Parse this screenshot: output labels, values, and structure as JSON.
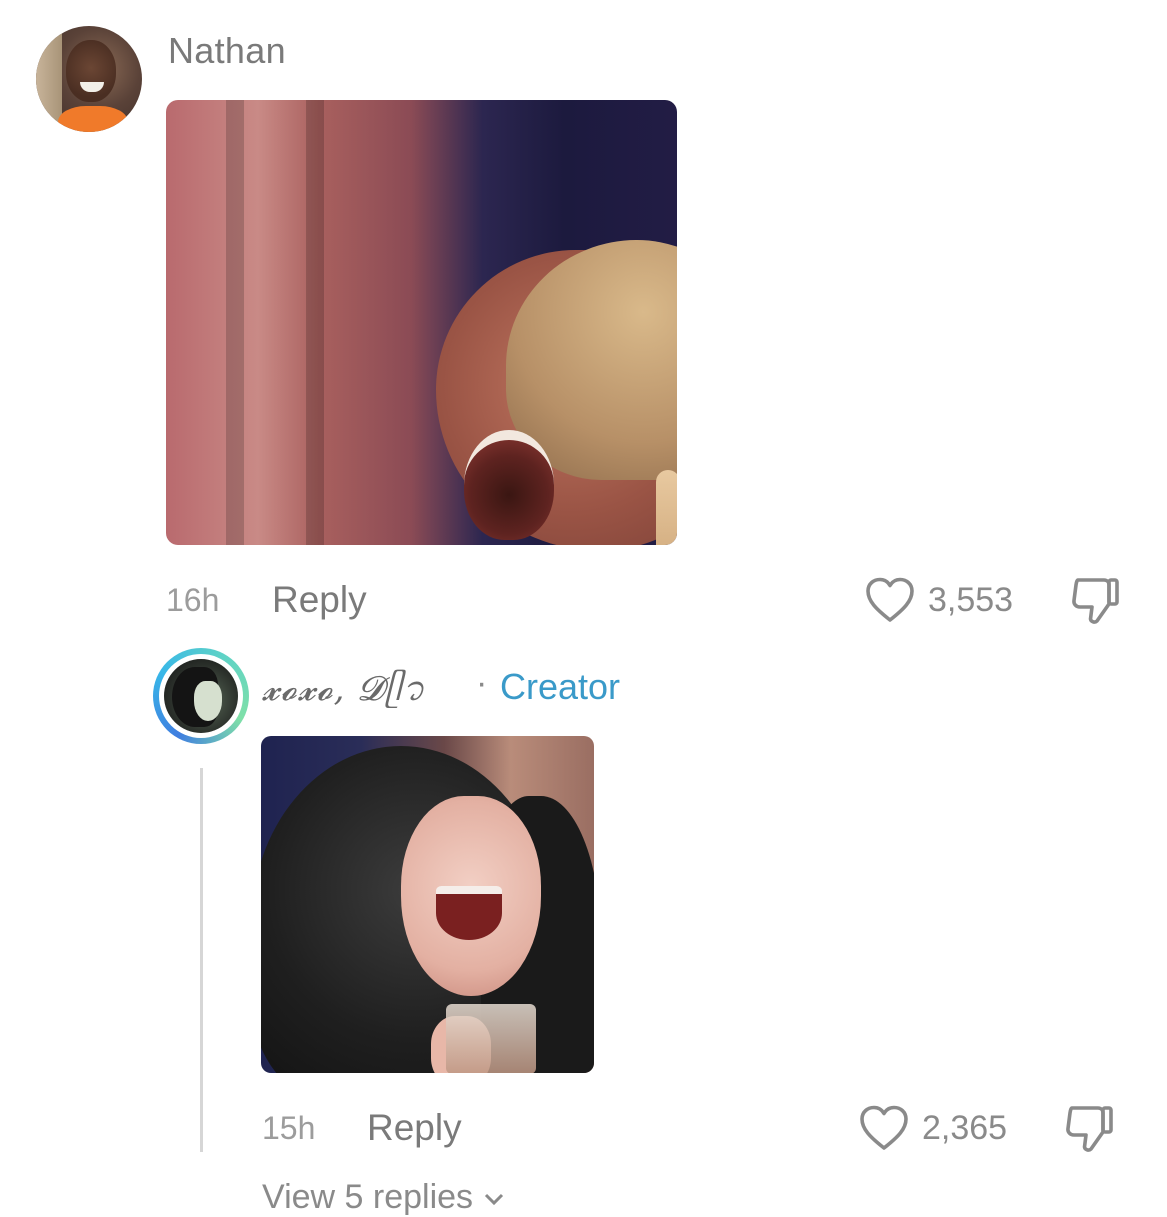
{
  "comments": [
    {
      "username": "Nathan",
      "time": "16h",
      "reply_label": "Reply",
      "like_count": "3,553",
      "media": "laughing-woman-gif"
    }
  ],
  "reply": {
    "username": "𝔁𝓸𝔁𝓸, 𝓓ᥫ᭡",
    "separator": "·",
    "badge": "Creator",
    "time": "15h",
    "reply_label": "Reply",
    "like_count": "2,365",
    "media": "laughing-woman-with-glass-gif"
  },
  "view_replies_label": "View 5 replies",
  "colors": {
    "creator_badge": "#3a9ac9",
    "text_muted": "#8a8a8a",
    "thread_line": "#d6d6d6"
  },
  "icons": {
    "like": "heart-outline-icon",
    "dislike": "thumbs-down-outline-icon",
    "expand": "chevron-down-icon"
  }
}
